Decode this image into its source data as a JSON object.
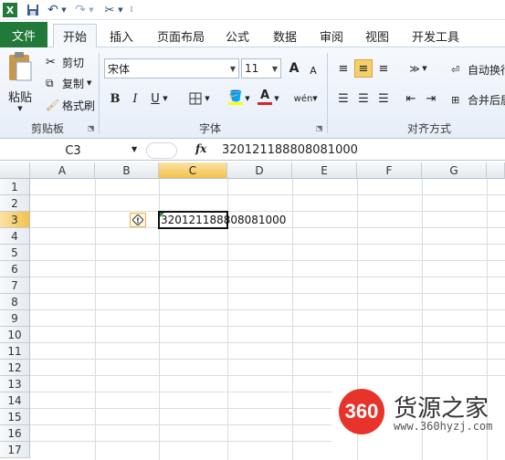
{
  "ribbon_tabs": {
    "file": "文件",
    "items": [
      "开始",
      "插入",
      "页面布局",
      "公式",
      "数据",
      "审阅",
      "视图",
      "开发工具"
    ],
    "active": "开始"
  },
  "clipboard": {
    "paste": "粘贴",
    "cut": "剪切",
    "copy": "复制",
    "format_painter": "格式刷",
    "group": "剪贴板"
  },
  "font": {
    "name": "宋体",
    "size": "11",
    "bold": "B",
    "italic": "I",
    "underline": "U",
    "grow": "A",
    "shrink": "A",
    "group": "字体",
    "phonetic": "wén"
  },
  "alignment": {
    "wrap": "自动换行",
    "merge": "合并后居中",
    "group": "对齐方式"
  },
  "formula_bar": {
    "name_box": "C3",
    "fx": "fx",
    "value": "320121188808081000"
  },
  "grid": {
    "columns": [
      "A",
      "B",
      "C",
      "D",
      "E",
      "F",
      "G"
    ],
    "rows": [
      "1",
      "2",
      "3",
      "4",
      "5",
      "6",
      "7",
      "8",
      "9",
      "10",
      "11",
      "12",
      "13",
      "14",
      "15",
      "16",
      "17"
    ],
    "selected_column": "C",
    "selected_row": "3",
    "cell_c3": "320121188808081000"
  },
  "watermark": {
    "badge": "360",
    "title": "货源之家",
    "url": "www.360hyzj.com"
  },
  "colors": {
    "file_tab": "#217a3a",
    "selected_header": "#f2c24c",
    "watermark_red": "#e8332a"
  }
}
